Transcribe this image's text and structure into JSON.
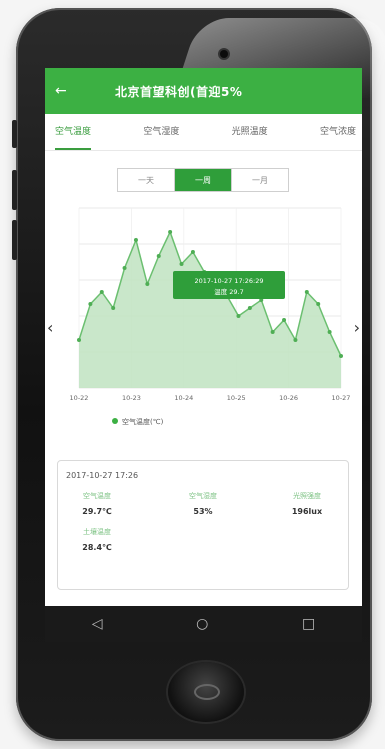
{
  "appbar": {
    "back_icon": "back-arrow-icon",
    "title": "北京首望科创(首迎5%"
  },
  "tabs": [
    "空气温度",
    "空气湿度",
    "光照温度",
    "空气浓度"
  ],
  "range_selector": [
    "一天",
    "一周",
    "一月"
  ],
  "chart": {
    "tooltip": [
      "2017-10-27 17:26:29",
      "温度 29.7"
    ],
    "legend": "空气温度(℃)",
    "x_labels": [
      "10-22",
      "10-23",
      "10-24",
      "10-25",
      "10-26",
      "10-27"
    ]
  },
  "detail_card": {
    "time": "2017-10-27 17:26",
    "cells": [
      {
        "label": "空气温度",
        "value": "29.7℃"
      },
      {
        "label": "空气湿度",
        "value": "53%"
      },
      {
        "label": "光照强度",
        "value": "196lux"
      },
      {
        "label": "土壤温度",
        "value": "28.4℃"
      }
    ]
  },
  "chart_data": {
    "type": "area",
    "x": [
      "10-22",
      "10-23",
      "10-24",
      "10-25",
      "10-26",
      "10-27"
    ],
    "series": [
      {
        "name": "空气温度(℃)",
        "values": [
          22,
          31,
          34,
          30,
          40,
          47,
          36,
          43,
          49,
          41,
          44,
          39,
          37,
          33,
          28,
          30,
          32,
          24,
          27,
          22,
          34,
          31,
          24,
          18
        ]
      }
    ],
    "ylim": [
      10,
      55
    ],
    "grid": true,
    "colors": {
      "line": "#6bbf70",
      "fill": "#bfe3c1",
      "accent": "#3cb043"
    }
  }
}
